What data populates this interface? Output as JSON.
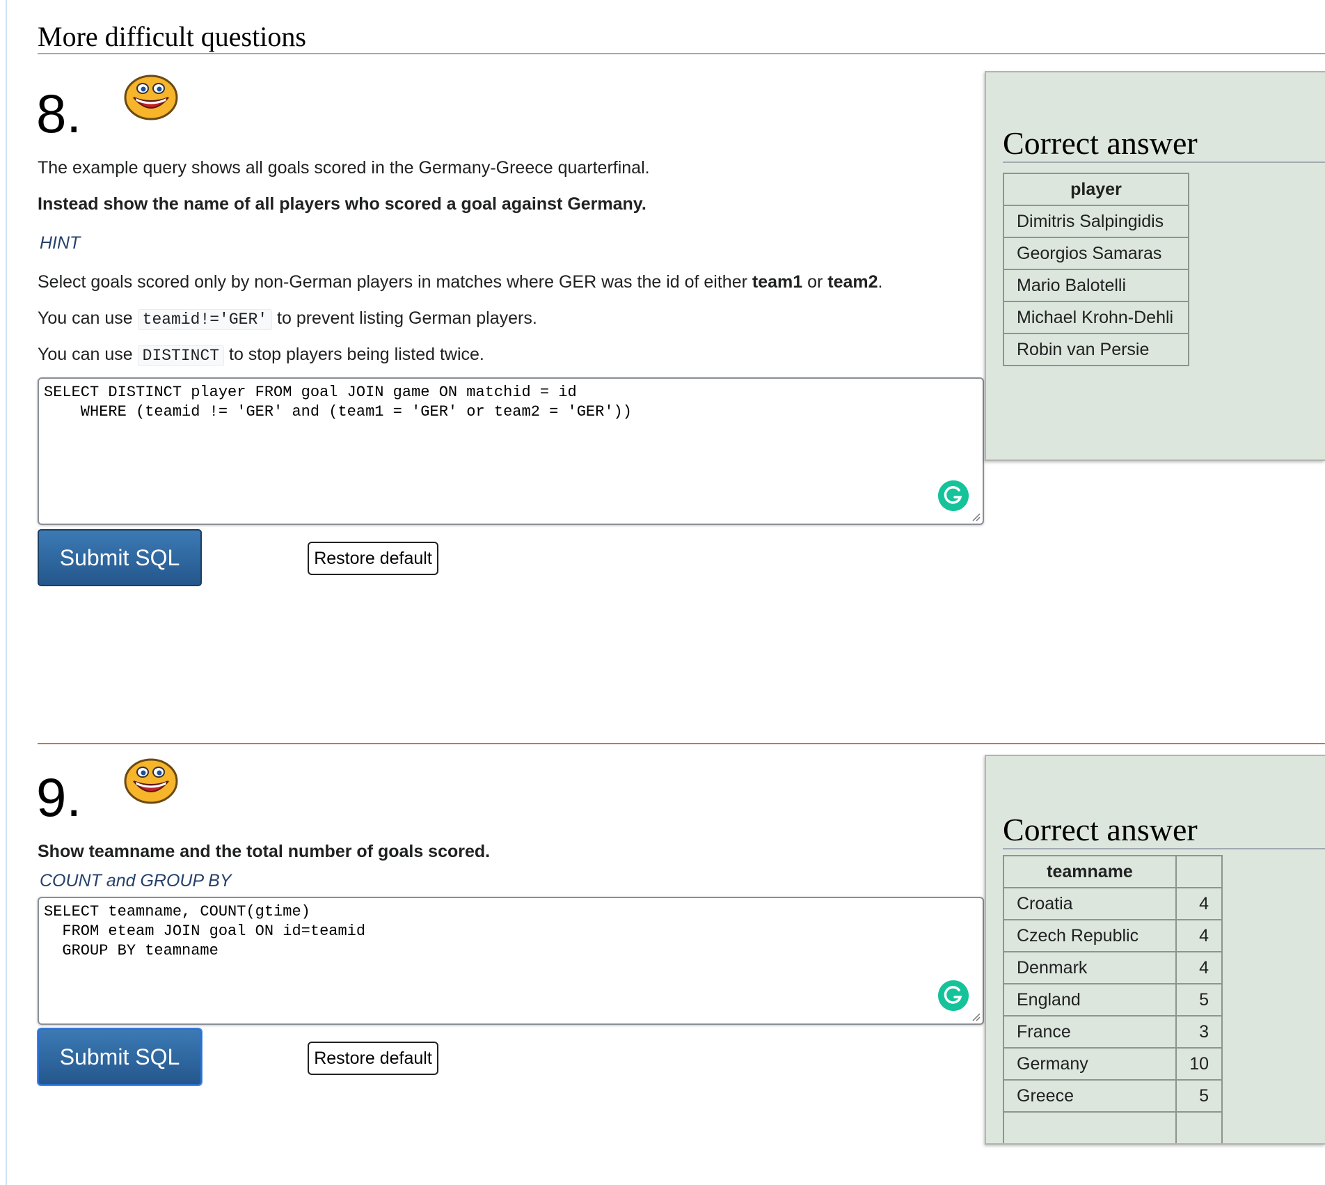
{
  "section_title": "More difficult questions",
  "q8": {
    "number": "8.",
    "intro": "The example query shows all goals scored in the Germany-Greece quarterfinal.",
    "task": "Instead show the name of all players who scored a goal against Germany.",
    "hint_label": "HINT",
    "hint_line1": {
      "pre": "Select goals scored only by non-German players in matches where GER was the id of either ",
      "b1": "team1",
      "mid": " or ",
      "b2": "team2",
      "post": "."
    },
    "hint_line2": {
      "pre": "You can use ",
      "code": "teamid!='GER'",
      "post": " to prevent listing German players."
    },
    "hint_line3": {
      "pre": "You can use ",
      "code": "DISTINCT",
      "post": " to stop players being listed twice."
    },
    "sql": "SELECT DISTINCT player FROM goal JOIN game ON matchid = id\n    WHERE (teamid != 'GER' and (team1 = 'GER' or team2 = 'GER'))",
    "submit_label": "Submit SQL",
    "restore_label": "Restore default",
    "answer": {
      "title": "Correct answer",
      "headers": [
        "player"
      ],
      "rows": [
        [
          "Dimitris Salpingidis"
        ],
        [
          "Georgios Samaras"
        ],
        [
          "Mario Balotelli"
        ],
        [
          "Michael Krohn-Dehli"
        ],
        [
          "Robin van Persie"
        ]
      ]
    }
  },
  "q9": {
    "number": "9.",
    "task": "Show teamname and the total number of goals scored.",
    "hint_label": "COUNT and GROUP BY",
    "sql": "SELECT teamname, COUNT(gtime)\n  FROM eteam JOIN goal ON id=teamid\n  GROUP BY teamname",
    "submit_label": "Submit SQL",
    "restore_label": "Restore default",
    "answer": {
      "title": "Correct answer",
      "headers": [
        "teamname",
        ""
      ],
      "rows": [
        [
          "Croatia",
          "4"
        ],
        [
          "Czech Republic",
          "4"
        ],
        [
          "Denmark",
          "4"
        ],
        [
          "England",
          "5"
        ],
        [
          "France",
          "3"
        ],
        [
          "Germany",
          "10"
        ],
        [
          "Greece",
          "5"
        ]
      ]
    }
  },
  "colors": {
    "accent_blue": "#2c6aa6",
    "divider_orange": "#d9722e",
    "answer_bg": "#dde6dc",
    "grammarly_green": "#15c39a"
  },
  "icons": {
    "smiley": "smiley-face-icon",
    "grammarly": "grammarly-icon",
    "resize": "resize-handle-icon"
  }
}
